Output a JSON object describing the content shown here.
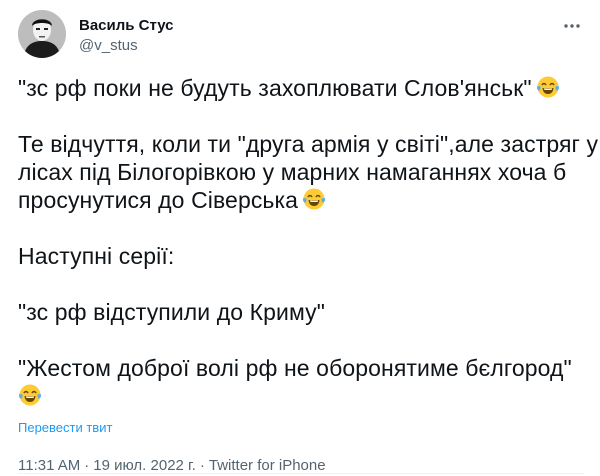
{
  "author": {
    "display_name": "Василь Стус",
    "handle": "@v_stus"
  },
  "tweet": {
    "lines": [
      "\"зс рф поки не будуть захоплювати Слов'янськ\"",
      "Те відчуття, коли ти \"друга армія у світі\",але застряг у",
      "лісах під Білогорівкою у марних намаганнях хоча б",
      "просунутися до Сіверська",
      "Наступні серії:",
      "\"зс рф відступили до Криму\"",
      "\"Жестом доброї волі рф не оборонятиме бєлгород\""
    ],
    "emoji": "face-with-tears-of-joy"
  },
  "translate_label": "Перевести твит",
  "meta": {
    "time": "11:31 AM",
    "date": "19 июл. 2022 г.",
    "separator": "·",
    "source": "Twitter for iPhone"
  },
  "colors": {
    "text": "#0f1419",
    "secondary": "#536471",
    "link": "#1d9bf0",
    "emoji_face": "#fdcb35"
  }
}
